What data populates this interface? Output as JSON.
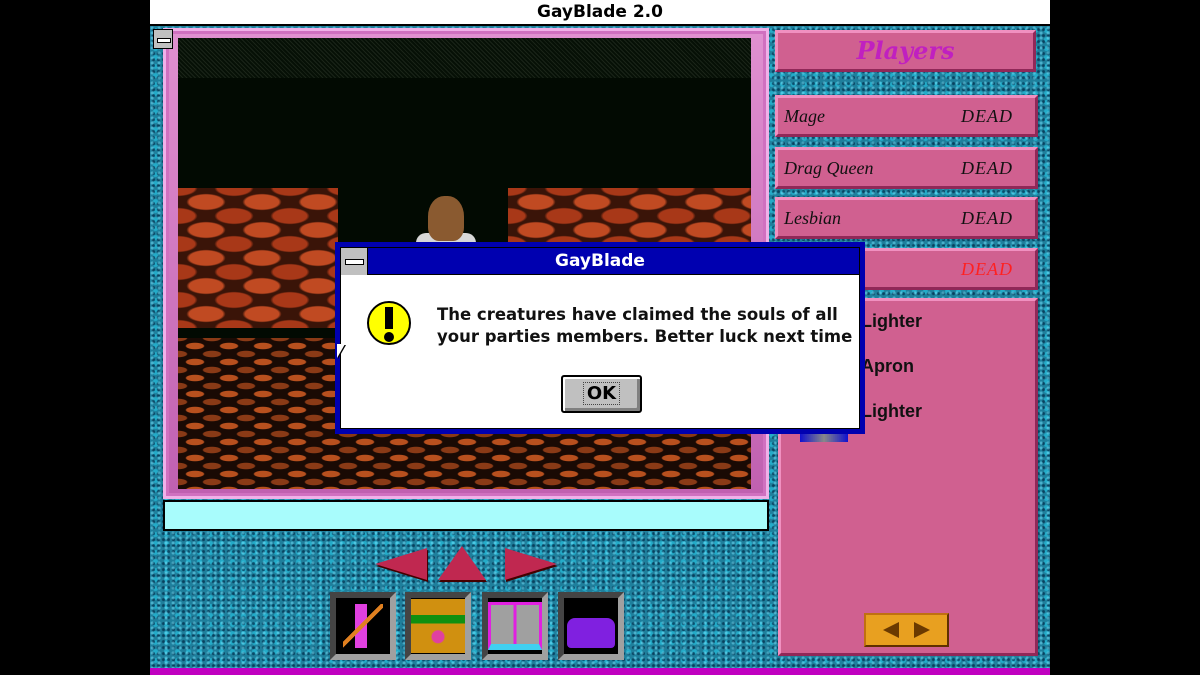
{
  "window": {
    "title": "GayBlade 2.0"
  },
  "players": {
    "header": "Players",
    "list": [
      {
        "name": "Mage",
        "status": "DEAD",
        "status_color": "#111111"
      },
      {
        "name": "Drag Queen",
        "status": "DEAD",
        "status_color": "#111111"
      },
      {
        "name": "Lesbian",
        "status": "DEAD",
        "status_color": "#111111"
      },
      {
        "name": "",
        "status": "DEAD",
        "status_color": "#ff2020"
      }
    ]
  },
  "items": [
    "Lighter",
    "Apron",
    "Lighter"
  ],
  "actions": [
    {
      "name": "use-item",
      "icon": "spray-sword-icon"
    },
    {
      "name": "character",
      "icon": "sunglasses-face-icon"
    },
    {
      "name": "spellbook",
      "icon": "book-icon"
    },
    {
      "name": "inventory",
      "icon": "purse-sword-icon"
    }
  ],
  "dialog": {
    "title": "GayBlade",
    "icon": "exclamation-icon",
    "message": "The creatures have claimed the souls of all your parties members. Better luck next time",
    "ok_label": "OK"
  },
  "colors": {
    "panel": "#d06090",
    "dialog_title": "#0000b0",
    "header_text": "#c020c0"
  }
}
